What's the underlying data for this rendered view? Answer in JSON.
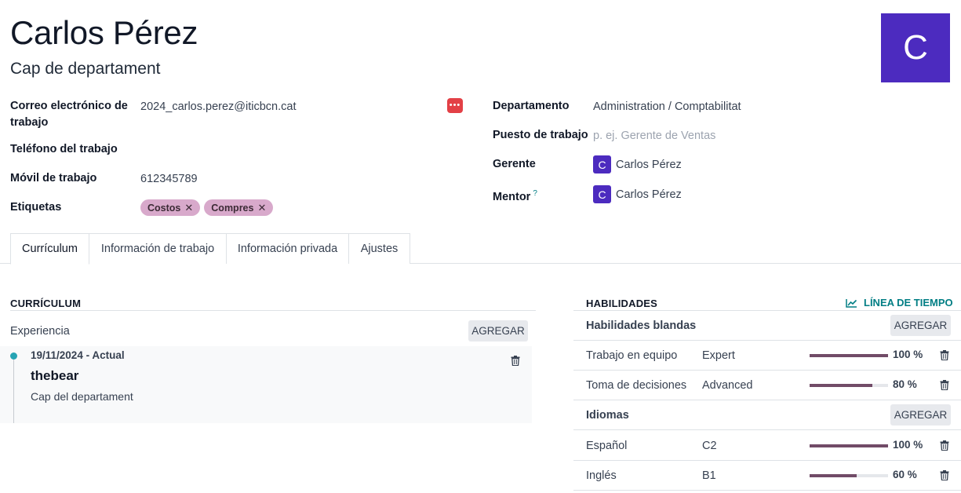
{
  "employee": {
    "name": "Carlos Pérez",
    "job_title": "Cap de departament",
    "avatar_letter": "C",
    "avatar_color": "#4c2bbf"
  },
  "fields_left": {
    "work_email_label_1": "Correo electrónico de",
    "work_email_label_2": "trabajo",
    "work_email": "2024_carlos.perez@iticbcn.cat",
    "work_phone_label": "Teléfono del trabajo",
    "work_phone": "",
    "mobile_label": "Móvil de trabajo",
    "mobile": "612345789",
    "tags_label": "Etiquetas",
    "tags": [
      "Costos",
      "Compres"
    ],
    "tag_color": "#d8a9cb"
  },
  "fields_right": {
    "department_label": "Departamento",
    "department": "Administration / Comptabilitat",
    "job_position_label": "Puesto de trabajo",
    "job_position_placeholder": "p. ej. Gerente de Ventas",
    "manager_label": "Gerente",
    "manager": "Carlos Pérez",
    "manager_initial": "C",
    "mentor_label": "Mentor",
    "mentor_help": "?",
    "mentor": "Carlos Pérez",
    "mentor_initial": "C"
  },
  "tabs": [
    {
      "label": "Currículum",
      "active": true
    },
    {
      "label": "Información de trabajo",
      "active": false
    },
    {
      "label": "Información privada",
      "active": false
    },
    {
      "label": "Ajustes",
      "active": false
    }
  ],
  "resume": {
    "section_title": "CURRÍCULUM",
    "group_label": "Experiencia",
    "add_label": "AGREGAR",
    "entries": [
      {
        "date": "19/11/2024 - Actual",
        "company": "thebear",
        "description": "Cap del departament"
      }
    ]
  },
  "skills": {
    "section_title": "HABILIDADES",
    "timeline_label": "LÍNEA DE TIEMPO",
    "accent_color": "#017e84",
    "bar_color": "#714b67",
    "groups": [
      {
        "name": "Habilidades blandas",
        "add_label": "AGREGAR",
        "items": [
          {
            "name": "Trabajo en equipo",
            "level": "Expert",
            "progress": 100,
            "progress_label": "100 %"
          },
          {
            "name": "Toma de decisiones",
            "level": "Advanced",
            "progress": 80,
            "progress_label": "80 %"
          }
        ]
      },
      {
        "name": "Idiomas",
        "add_label": "AGREGAR",
        "items": [
          {
            "name": "Español",
            "level": "C2",
            "progress": 100,
            "progress_label": "100 %"
          },
          {
            "name": "Inglés",
            "level": "B1",
            "progress": 60,
            "progress_label": "60 %"
          }
        ]
      }
    ]
  },
  "icons": {
    "email_action": "more-dots-icon",
    "trash": "trash-icon",
    "timeline": "line-chart-icon",
    "tag_remove": "close-icon"
  }
}
